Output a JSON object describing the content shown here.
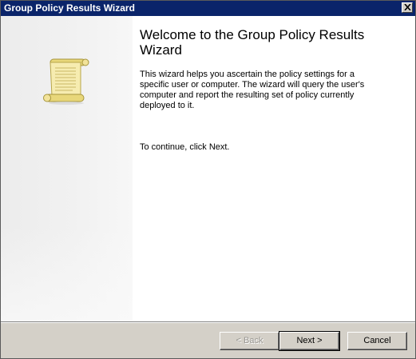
{
  "window": {
    "title": "Group Policy Results Wizard"
  },
  "icons": {
    "close": "close-icon",
    "wizard": "scroll-icon"
  },
  "page": {
    "heading": "Welcome to the Group Policy Results Wizard",
    "description": "This wizard helps you ascertain the policy settings for a specific user or computer. The wizard will query the user's computer and report the resulting set of policy currently deployed to it.",
    "continue_text": "To continue, click Next."
  },
  "buttons": {
    "back": "< Back",
    "next": "Next >",
    "cancel": "Cancel"
  },
  "colors": {
    "titlebar": "#0a246a",
    "dialog": "#d4d0c8"
  }
}
